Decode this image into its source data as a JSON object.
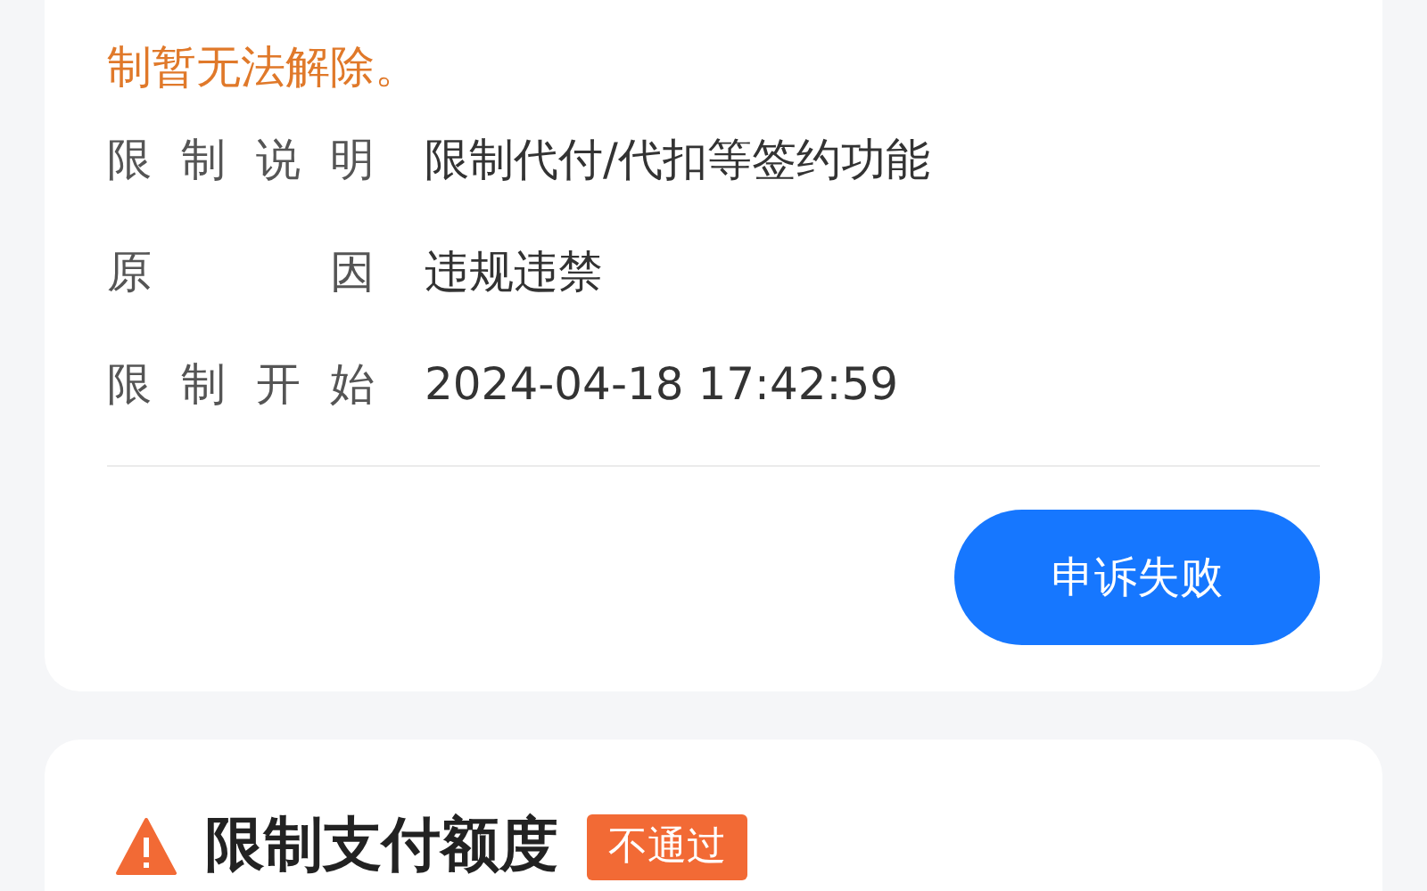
{
  "notice": {
    "lines": [
      "制暂无法解除。"
    ]
  },
  "details": [
    {
      "label": "限制说明",
      "value": "限制代付/代扣等签约功能"
    },
    {
      "label": "原因",
      "value": "违规违禁"
    },
    {
      "label": "限制开始",
      "value": "2024-04-18 17:42:59"
    }
  ],
  "appeal_button": "申诉失败",
  "next_card": {
    "title": "限制支付额度",
    "status": "不通过"
  }
}
